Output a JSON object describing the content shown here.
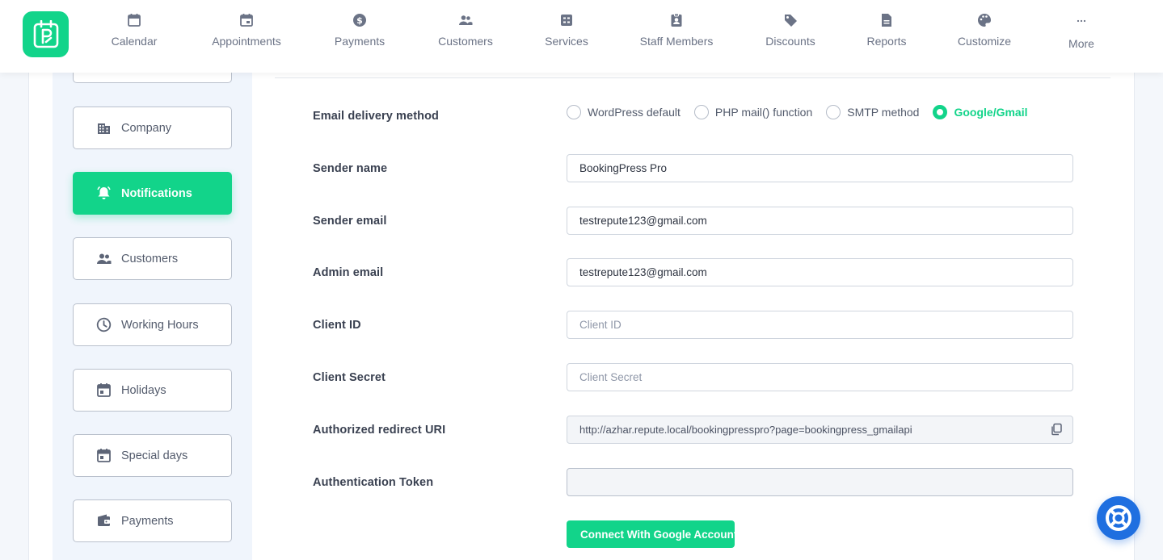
{
  "colors": {
    "accent": "#12d48a",
    "help": "#1f6fe0",
    "sidebar_bg": "#f0f5fc"
  },
  "nav": {
    "items": [
      {
        "label": "Calendar",
        "icon": "calendar-icon"
      },
      {
        "label": "Appointments",
        "icon": "appointments-icon"
      },
      {
        "label": "Payments",
        "icon": "payments-icon"
      },
      {
        "label": "Customers",
        "icon": "customers-icon"
      },
      {
        "label": "Services",
        "icon": "services-icon"
      },
      {
        "label": "Staff Members",
        "icon": "staff-icon"
      },
      {
        "label": "Discounts",
        "icon": "tag-icon"
      },
      {
        "label": "Reports",
        "icon": "reports-icon"
      },
      {
        "label": "Customize",
        "icon": "palette-icon"
      },
      {
        "label": "More",
        "icon": "more-icon"
      }
    ]
  },
  "sidebar": {
    "items": [
      {
        "label": "Company",
        "icon": "building-icon",
        "active": false
      },
      {
        "label": "Notifications",
        "icon": "bell-icon",
        "active": true
      },
      {
        "label": "Customers",
        "icon": "customers-icon",
        "active": false
      },
      {
        "label": "Working Hours",
        "icon": "clock-icon",
        "active": false
      },
      {
        "label": "Holidays",
        "icon": "calendar-icon",
        "active": false
      },
      {
        "label": "Special days",
        "icon": "calendar-icon",
        "active": false
      },
      {
        "label": "Payments",
        "icon": "wallet-icon",
        "active": false
      }
    ]
  },
  "form": {
    "delivery_label": "Email delivery method",
    "delivery_options": [
      "WordPress default",
      "PHP mail() function",
      "SMTP method",
      "Google/Gmail"
    ],
    "delivery_selected": "Google/Gmail",
    "sender_name_label": "Sender name",
    "sender_name_value": "BookingPress Pro",
    "sender_email_label": "Sender email",
    "sender_email_value": "testrepute123@gmail.com",
    "admin_email_label": "Admin email",
    "admin_email_value": "testrepute123@gmail.com",
    "client_id_label": "Client ID",
    "client_id_placeholder": "Client ID",
    "client_secret_label": "Client Secret",
    "client_secret_placeholder": "Client Secret",
    "redirect_label": "Authorized redirect URI",
    "redirect_value": "http://azhar.repute.local/bookingpresspro?page=bookingpress_gmailapi",
    "token_label": "Authentication Token",
    "token_value": "",
    "connect_button": "Connect With Google Account"
  }
}
